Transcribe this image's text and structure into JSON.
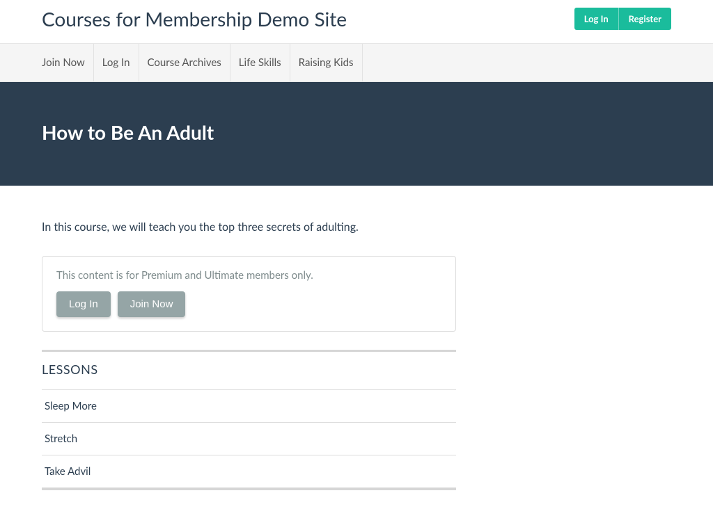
{
  "header": {
    "site_title": "Courses for Membership Demo Site",
    "auth": {
      "login": "Log In",
      "register": "Register"
    }
  },
  "nav": {
    "items": [
      {
        "label": "Join Now"
      },
      {
        "label": "Log In"
      },
      {
        "label": "Course Archives"
      },
      {
        "label": "Life Skills"
      },
      {
        "label": "Raising Kids"
      }
    ]
  },
  "hero": {
    "title": "How to Be An Adult"
  },
  "content": {
    "intro": "In this course, we will teach you the top three secrets of adulting.",
    "restricted": {
      "message": "This content is for Premium and Ultimate members only.",
      "login_label": "Log In",
      "join_label": "Join Now"
    },
    "lessons_heading": "LESSONS",
    "lessons": [
      {
        "title": "Sleep More"
      },
      {
        "title": "Stretch"
      },
      {
        "title": "Take Advil"
      }
    ]
  }
}
